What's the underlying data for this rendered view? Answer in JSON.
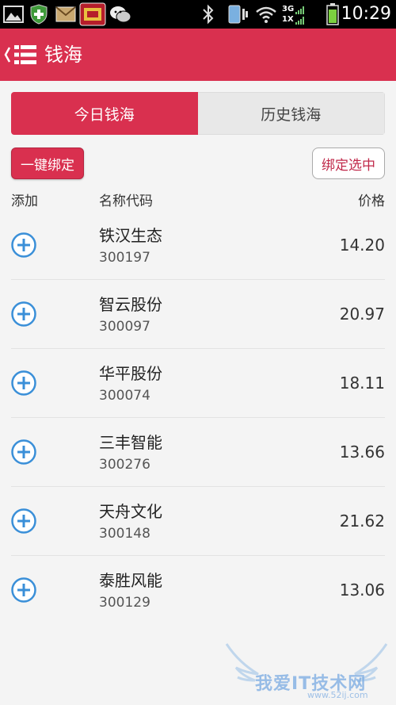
{
  "status_bar": {
    "time": "10:29",
    "network_top": "3G",
    "network_bottom": "1X"
  },
  "header": {
    "title": "钱海"
  },
  "tabs": [
    {
      "label": "今日钱海",
      "active": true
    },
    {
      "label": "历史钱海",
      "active": false
    }
  ],
  "actions": {
    "bind_all_label": "一键绑定",
    "bind_selected_label": "绑定选中"
  },
  "columns": {
    "add": "添加",
    "name_code": "名称代码",
    "price": "价格"
  },
  "stocks": [
    {
      "name": "铁汉生态",
      "code": "300197",
      "price": "14.20"
    },
    {
      "name": "智云股份",
      "code": "300097",
      "price": "20.97"
    },
    {
      "name": "华平股份",
      "code": "300074",
      "price": "18.11"
    },
    {
      "name": "三丰智能",
      "code": "300276",
      "price": "13.66"
    },
    {
      "name": "天舟文化",
      "code": "300148",
      "price": "21.62"
    },
    {
      "name": "泰胜风能",
      "code": "300129",
      "price": "13.06"
    }
  ],
  "watermark": {
    "text": "我爱IT技术网",
    "url": "www.52ij.com"
  },
  "colors": {
    "brand": "#d9304f",
    "add_icon": "#3a8fd8"
  }
}
